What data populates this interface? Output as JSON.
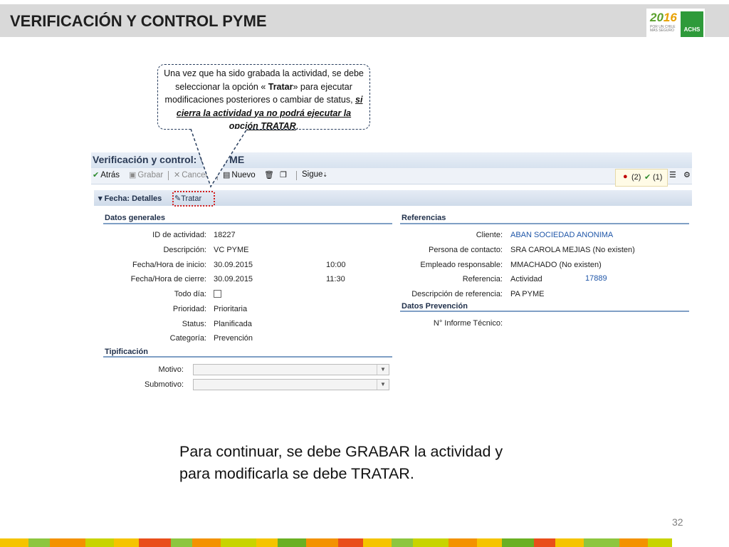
{
  "slide": {
    "title": "VERIFICACIÓN Y CONTROL PYME",
    "page_number": "32",
    "bottom_text_line1": "Para continuar, se debe GRABAR la actividad y",
    "bottom_text_line2": "para modificarla se debe TRATAR."
  },
  "logo": {
    "year_a": "20",
    "year_b": "16",
    "tagline": "POR UN CHILE MÁS SEGURO",
    "brand": "ACHS"
  },
  "callout": {
    "t1": "Una vez que ha sido grabada la actividad, se debe seleccionar la opción « ",
    "t2": "Tratar",
    "t3": "» para ejecutar modificaciones posteriores o cambiar de status, ",
    "t4": "si cierra la actividad ya no podrá ejecutar la opción  TRATAR",
    "t5": "."
  },
  "app": {
    "title": "Verificación y control: VC PYME",
    "toolbar": {
      "back": "Atrás",
      "save": "Grabar",
      "cancel": "Cancelar",
      "new": "Nuevo",
      "next": "Sigue"
    },
    "status": {
      "errors": "(2)",
      "ok": "(1)"
    },
    "section_title": "Fecha: Detalles",
    "tratar": "Tratar"
  },
  "general": {
    "title": "Datos generales",
    "rows": [
      {
        "label": "ID de actividad:",
        "value": "18227"
      },
      {
        "label": "Descripción:",
        "value": "VC PYME"
      },
      {
        "label": "Fecha/Hora de inicio:",
        "value": "30.09.2015",
        "time": "10:00"
      },
      {
        "label": "Fecha/Hora de cierre:",
        "value": "30.09.2015",
        "time": "11:30"
      },
      {
        "label": "Todo día:",
        "value": ""
      },
      {
        "label": "Prioridad:",
        "value": "Prioritaria"
      },
      {
        "label": "Status:",
        "value": "Planificada"
      },
      {
        "label": "Categoría:",
        "value": "Prevención"
      }
    ]
  },
  "tipificacion": {
    "title": "Tipificación",
    "motivo": "Motivo:",
    "submotivo": "Submotivo:"
  },
  "referencias": {
    "title": "Referencias",
    "rows": [
      {
        "label": "Cliente:",
        "value": "ABAN SOCIEDAD ANONIMA"
      },
      {
        "label": "Persona de contacto:",
        "value": "SRA CAROLA MEJIAS (No existen)"
      },
      {
        "label": "Empleado responsable:",
        "value": "MMACHADO (No existen)"
      },
      {
        "label": "Referencia:",
        "value": "Actividad",
        "extra": "17889"
      },
      {
        "label": "Descripción de referencia:",
        "value": "PA PYME"
      }
    ]
  },
  "prevencion": {
    "title": "Datos Prevención",
    "label": "N° Informe Técnico:"
  },
  "colors": {
    "header_bg": "#d9d9d9",
    "link": "#1f56a8",
    "tratar_highlight": "#d11c1c",
    "group_line": "#7f9fc5"
  }
}
